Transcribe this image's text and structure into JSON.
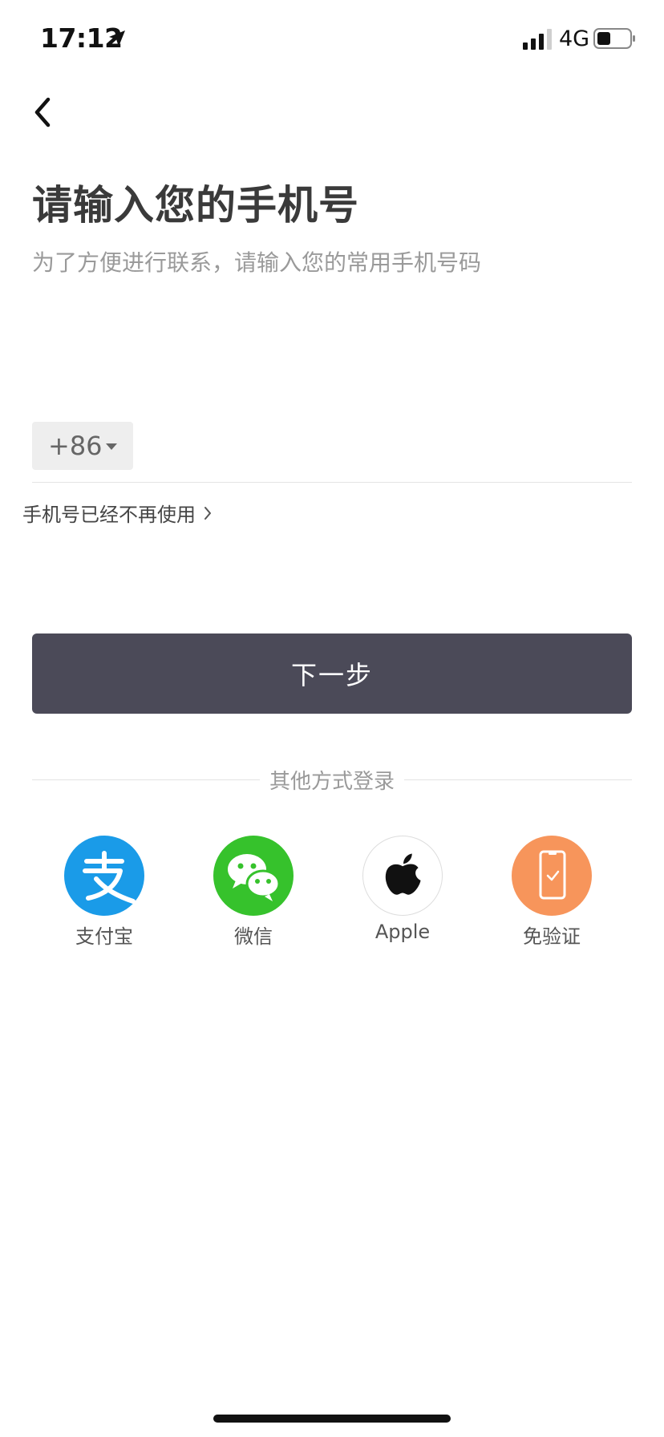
{
  "status_bar": {
    "time": "17:12",
    "network": "4G",
    "icons": [
      "location-arrow-icon",
      "signal-icon",
      "battery-icon"
    ]
  },
  "nav": {
    "back_icon": "chevron-left-icon"
  },
  "header": {
    "title": "请输入您的手机号",
    "subtitle": "为了方便进行联系，请输入您的常用手机号码"
  },
  "phone_form": {
    "country_code": "+86",
    "phone_value": "",
    "phone_unused_link": "手机号已经不再使用",
    "next_button": "下一步"
  },
  "other_login": {
    "label": "其他方式登录",
    "options": [
      {
        "label": "支付宝",
        "icon": "alipay-icon",
        "color": "#1a9be8"
      },
      {
        "label": "微信",
        "icon": "wechat-icon",
        "color": "#36c22c"
      },
      {
        "label": "Apple",
        "icon": "apple-icon",
        "color": "#ffffff"
      },
      {
        "label": "免验证",
        "icon": "phone-check-icon",
        "color": "#f7955b"
      }
    ]
  },
  "colors": {
    "primary_button": "#4b4a58",
    "title_text": "#3a3a3a",
    "muted_text": "#9a9a9a"
  }
}
